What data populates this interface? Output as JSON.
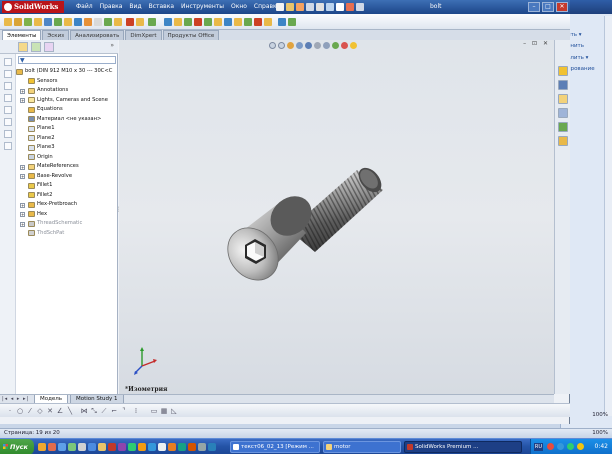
{
  "app": {
    "logo_text": "SolidWorks",
    "window_title": "bolt",
    "menu": [
      "Файл",
      "Правка",
      "Вид",
      "Вставка",
      "Инструменты",
      "Окно",
      "Справка"
    ],
    "colors": {
      "titlebar": "#1c4689",
      "logo": "#b9141a",
      "accent": "#3d6fb5"
    }
  },
  "command_tabs": [
    "Элементы",
    "Эскиз",
    "Анализировать",
    "DimXpert",
    "Продукты Office"
  ],
  "feature_tree": {
    "filter_icon": "filter-icon",
    "more_label": "»",
    "items": [
      {
        "label": "bolt  (DIN 912 M10 x 30 --- 30C<C",
        "icon": "part-icon",
        "expand": false
      },
      {
        "label": "Sensors",
        "icon": "sensors-icon",
        "expand": false
      },
      {
        "label": "Annotations",
        "icon": "annotations-icon",
        "expand": true
      },
      {
        "label": "Lights, Cameras and Scene",
        "icon": "lights-icon",
        "expand": true
      },
      {
        "label": "Equations",
        "icon": "equations-icon",
        "expand": false
      },
      {
        "label": "Материал <не указан>",
        "icon": "material-icon",
        "expand": false
      },
      {
        "label": "Plane1",
        "icon": "plane-icon",
        "expand": false
      },
      {
        "label": "Plane2",
        "icon": "plane-icon",
        "expand": false
      },
      {
        "label": "Plane3",
        "icon": "plane-icon",
        "expand": false
      },
      {
        "label": "Origin",
        "icon": "origin-icon",
        "expand": false
      },
      {
        "label": "MateReferences",
        "icon": "mate-references-icon",
        "expand": true
      },
      {
        "label": "Base-Revolve",
        "icon": "revolve-icon",
        "expand": true
      },
      {
        "label": "Fillet1",
        "icon": "fillet-icon",
        "expand": false
      },
      {
        "label": "Fillet2",
        "icon": "fillet-icon",
        "expand": false
      },
      {
        "label": "Hex-Pretbroach",
        "icon": "cut-icon",
        "expand": true
      },
      {
        "label": "Hex",
        "icon": "cut-icon",
        "expand": true
      },
      {
        "label": "ThreadSchematic",
        "icon": "thread-icon",
        "expand": true,
        "grey": true
      },
      {
        "label": "ThdSchPat",
        "icon": "pattern-icon",
        "expand": false,
        "grey": true
      }
    ]
  },
  "viewport": {
    "view_name": "*Изометрия",
    "window_controls": "– ⊡ ✕"
  },
  "bottom_tabs": [
    "Модель",
    "Motion Study 1"
  ],
  "bottom_nav": "|◂ ◂ ▸ ▸|",
  "background_app": {
    "ribbon_items": [
      "ить ▾",
      "енить",
      "елить ▾",
      "ирование"
    ],
    "zoom": "100%"
  },
  "status_bar": {
    "page": "Страница: 19 из 20",
    "zoom": "100%"
  },
  "taskbar": {
    "start_label": "Пуск",
    "buttons": [
      {
        "label": "текст06_02_13 [Режим ...",
        "active": false
      },
      {
        "label": "motor",
        "active": false
      },
      {
        "label": "SolidWorks Premium ...",
        "active": true
      }
    ],
    "lang": "RU",
    "clock": "0:42"
  }
}
